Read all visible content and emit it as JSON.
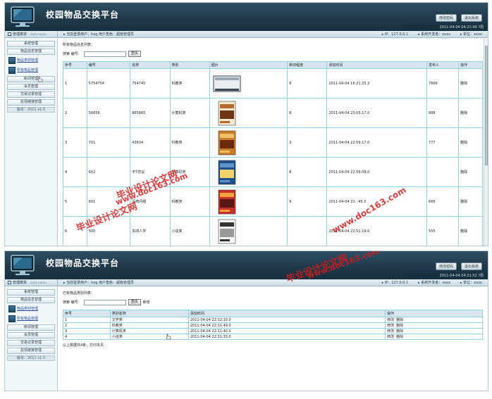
{
  "app": {
    "title": "校园物品交换平台",
    "btn_change_password": "修改密码",
    "btn_logout": "退出系统"
  },
  "shot1": {
    "clock": "2011-04-04 04:21:49 ?周",
    "infobar": {
      "menu_title": "管理菜单",
      "menu_en": "main menu",
      "user_info": "当前登录用户：hxg  用户角色：超级管理员",
      "ip": "IP：127.0.0.1",
      "dev": "系统开发者：xxxx",
      "unit": "单位：xxxx"
    },
    "sidebar": {
      "item_system": "系统管理",
      "item_goods_info": "物品信息管理",
      "item_goods_category": "物品类别管理",
      "item_all_goods": "所有物品管理",
      "item_news": "新闻管理",
      "item_members": "会员管理",
      "item_trade_records": "交易记录管理",
      "item_links": "友情链接管理",
      "version": "版本：2011 v1.0"
    },
    "main": {
      "heading": "所有物品信息列表：",
      "search_label": "搜索 编号：",
      "search_value": "",
      "search_button": "查找",
      "columns": [
        "序号",
        "编号",
        "名称",
        "类别",
        "图片",
        "新旧程度",
        "添加时间",
        "发布人",
        "操作"
      ],
      "rows": [
        {
          "seq": "1",
          "code": "5754754",
          "name": "754745",
          "category": "科教类",
          "image": "appliance",
          "condition": "8",
          "added": "2011-04-04 16:21:25.2",
          "publisher": "7666",
          "op": "删除"
        },
        {
          "seq": "2",
          "code": "56856",
          "name": "865865",
          "category": "计算机类",
          "image": "book",
          "condition": "8",
          "added": "2011-04-04 23:05:17.0",
          "publisher": "888",
          "op": "删除"
        },
        {
          "seq": "3",
          "code": "701",
          "name": "43634",
          "category": "科教类",
          "image": "book-cn",
          "condition": "3",
          "added": "2011-04-04 22:59:17.0",
          "publisher": "777",
          "op": "删除"
        },
        {
          "seq": "4",
          "code": "602",
          "name": "不T您议",
          "category": "计算机类",
          "image": "book-blue",
          "condition": "8",
          "added": "2011-04-04 22:56:08.0",
          "publisher": "",
          "op": "删除"
        },
        {
          "seq": "5",
          "code": "601",
          "name": "品牌问题",
          "category": "科教类",
          "image": "book-red",
          "condition": "9",
          "added": "2011-04-04 22:  :45.0",
          "publisher": "666",
          "op": "删除"
        },
        {
          "seq": "6",
          "code": "500",
          "name": "东四人学",
          "category": "小说类",
          "image": "book-bw",
          "condition": "",
          "added": "2011-04-04 22:51:19.0",
          "publisher": "555",
          "op": "删除"
        }
      ]
    }
  },
  "shot2": {
    "clock": "2011-04-04 04:21:52 ?周",
    "infobar": {
      "menu_title": "管理菜单",
      "menu_en": "main menu",
      "user_info": "当前登录用户：hxg  用户角色：超级管理员",
      "ip": "IP：127.0.0.1",
      "dev": "系统开发者：xxxx",
      "unit": "单位：xxxx"
    },
    "sidebar": {
      "item_system": "系统管理",
      "item_goods_info": "物品信息管理",
      "item_goods_category": "物品类别管理",
      "item_all_goods": "所有物品管理",
      "item_news": "新闻管理",
      "item_members": "会员管理",
      "item_trade_records": "交易记录管理",
      "item_links": "友情链接管理",
      "version": "版本：2011 v1.0"
    },
    "main": {
      "heading": "已有物品类别列表：",
      "search_label": "搜索 编号：",
      "search_value": "",
      "search_button": "查找",
      "add_link": "新增",
      "columns": [
        "序号",
        "类别名称",
        "添加时间",
        "操作"
      ],
      "rows": [
        {
          "seq": "1",
          "name": "文学类",
          "added": "2011-04-04 22:32:10.0",
          "edit": "修改",
          "del": "删除"
        },
        {
          "seq": "2",
          "name": "科教类",
          "added": "2011-04-04 22:31:49.0",
          "edit": "修改",
          "del": "删除"
        },
        {
          "seq": "3",
          "name": "计算机类",
          "added": "2011-04-04 22:31:40.0",
          "edit": "修改",
          "del": "删除"
        },
        {
          "seq": "4",
          "name": "小说类",
          "added": "2011-04-04 22:31:33.0",
          "edit": "修改",
          "del": "删除"
        }
      ],
      "footnote": "以上数据共4条，打印本页"
    }
  },
  "watermarks": {
    "w1": "毕业设计论文网",
    "w2": "www.doc163.com",
    "w3": "毕业设计论文网",
    "w4": "www.doc163.com",
    "w5": "毕业设计论文网",
    "w6": "www.doc163.com"
  },
  "colors": {
    "header": "#203a4b",
    "table_border": "#8fd5e0",
    "table_head": "#d7e6ee",
    "watermark": "#d61b1b"
  }
}
